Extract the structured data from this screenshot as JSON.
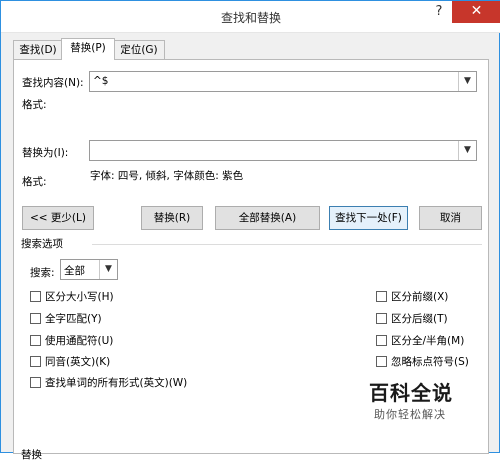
{
  "window": {
    "title": "查找和替换",
    "help": "?",
    "close": "✕"
  },
  "tabs": [
    {
      "label": "查找(D)",
      "active": false
    },
    {
      "label": "替换(P)",
      "active": true
    },
    {
      "label": "定位(G)",
      "active": false
    }
  ],
  "find": {
    "label": "查找内容(N):",
    "value": "^$",
    "format_label": "格式:"
  },
  "replace": {
    "label": "替换为(I):",
    "value": "",
    "format_label": "格式:",
    "format_value": "字体: 四号, 倾斜, 字体颜色: 紫色"
  },
  "buttons": {
    "less": "<< 更少(L)",
    "replace": "替换(R)",
    "replace_all": "全部替换(A)",
    "find_next": "查找下一处(F)",
    "cancel": "取消"
  },
  "search_options": {
    "heading": "搜索选项",
    "search_label": "搜索:",
    "search_value": "全部",
    "left_checks": [
      "区分大小写(H)",
      "全字匹配(Y)",
      "使用通配符(U)",
      "同音(英文)(K)",
      "查找单词的所有形式(英文)(W)"
    ],
    "right_checks": [
      "区分前缀(X)",
      "区分后缀(T)",
      "区分全/半角(M)",
      "忽略标点符号(S)"
    ]
  },
  "bottom_partial": "替换",
  "watermark": {
    "title": "百科全说",
    "subtitle": "助你轻松解决"
  }
}
